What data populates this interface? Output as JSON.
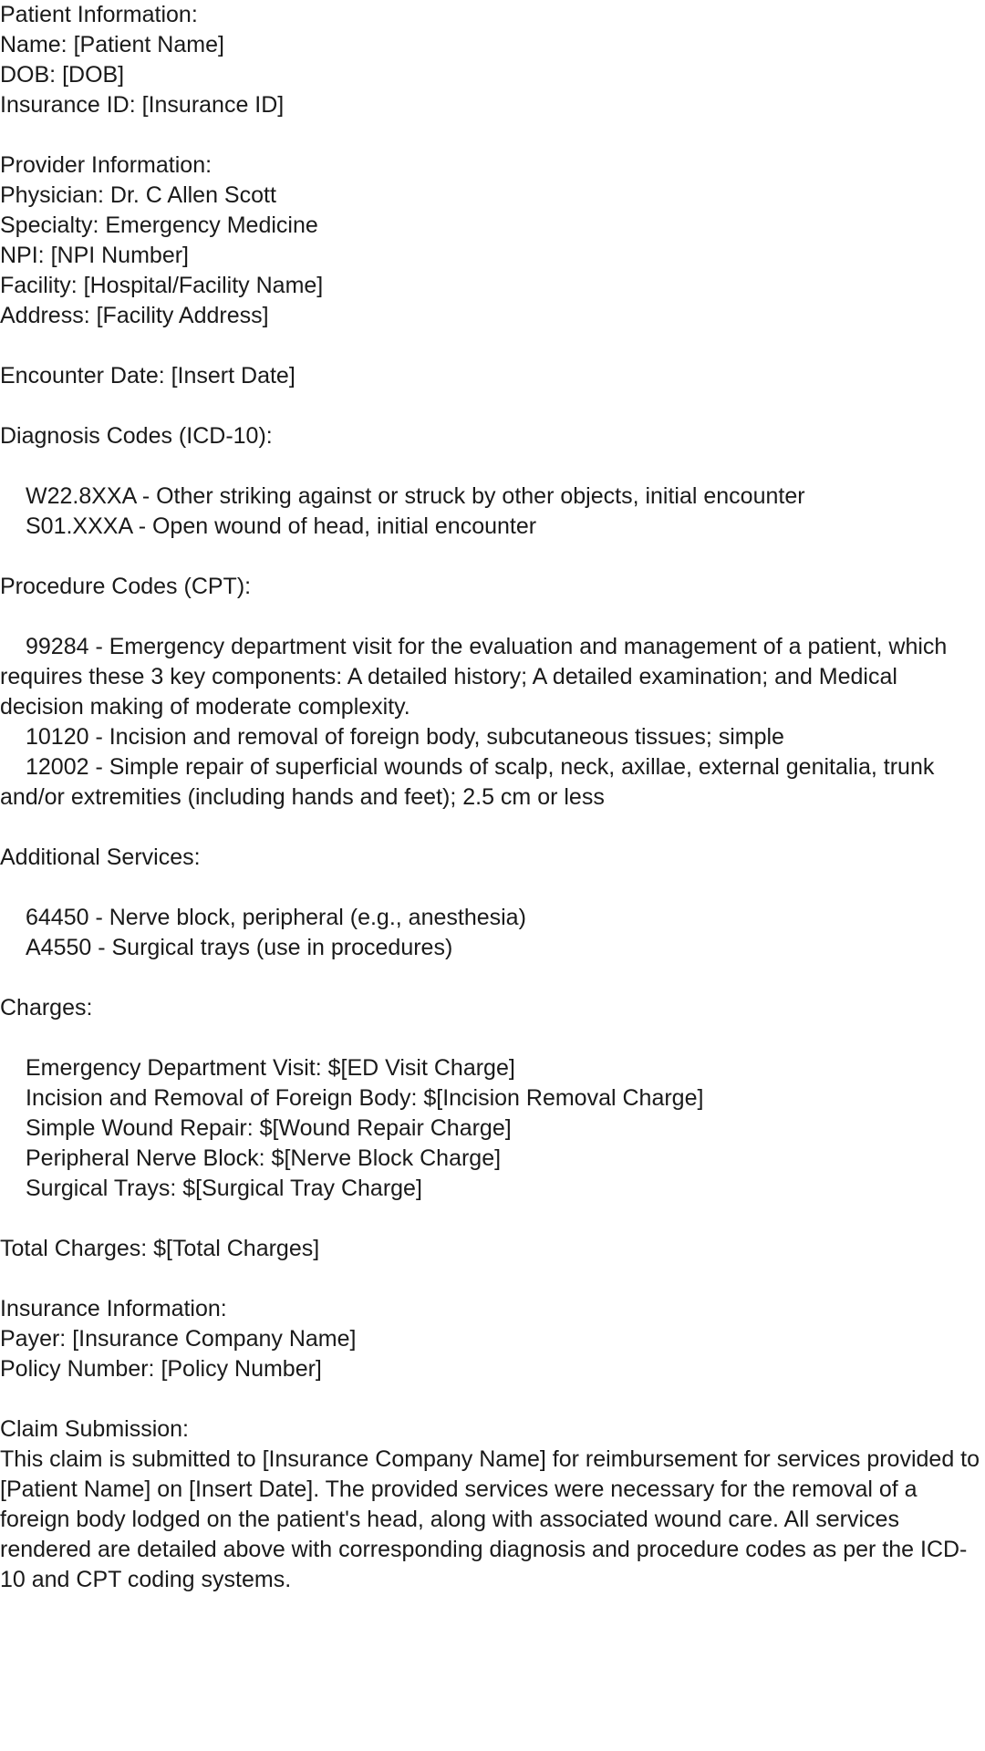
{
  "patient": {
    "heading": "Patient Information:",
    "name": "Name: [Patient Name]",
    "dob": "DOB: [DOB]",
    "insurance_id": "Insurance ID: [Insurance ID]"
  },
  "provider": {
    "heading": "Provider Information:",
    "physician": "Physician: Dr. C Allen Scott",
    "specialty": "Specialty: Emergency Medicine",
    "npi": "NPI: [NPI Number]",
    "facility": "Facility: [Hospital/Facility Name]",
    "address": "Address: [Facility Address]"
  },
  "encounter": {
    "date": "Encounter Date: [Insert Date]"
  },
  "diagnosis": {
    "heading": "Diagnosis Codes (ICD-10):",
    "items": [
      "W22.8XXA - Other striking against or struck by other objects, initial encounter",
      "S01.XXXA - Open wound of head, initial encounter"
    ]
  },
  "procedures": {
    "heading": "Procedure Codes (CPT):",
    "items": [
      "99284 - Emergency department visit for the evaluation and management of a patient, which requires these 3 key components: A detailed history; A detailed examination; and Medical decision making of moderate complexity.",
      "10120 - Incision and removal of foreign body, subcutaneous tissues; simple",
      "12002 - Simple repair of superficial wounds of scalp, neck, axillae, external genitalia, trunk and/or extremities (including hands and feet); 2.5 cm or less"
    ]
  },
  "additional": {
    "heading": "Additional Services:",
    "items": [
      "64450 - Nerve block, peripheral (e.g., anesthesia)",
      "A4550 - Surgical trays (use in procedures)"
    ]
  },
  "charges": {
    "heading": "Charges:",
    "items": [
      "Emergency Department Visit: $[ED Visit Charge]",
      "Incision and Removal of Foreign Body: $[Incision Removal Charge]",
      "Simple Wound Repair: $[Wound Repair Charge]",
      "Peripheral Nerve Block: $[Nerve Block Charge]",
      "Surgical Trays: $[Surgical Tray Charge]"
    ],
    "total": "Total Charges: $[Total Charges]"
  },
  "insurance": {
    "heading": "Insurance Information:",
    "payer": "Payer: [Insurance Company Name]",
    "policy": "Policy Number: [Policy Number]"
  },
  "claim": {
    "heading": "Claim Submission:",
    "body": "This claim is submitted to [Insurance Company Name] for reimbursement for services provided to [Patient Name] on [Insert Date]. The provided services were necessary for the removal of a foreign body lodged on the patient's head, along with associated wound care. All services rendered are detailed above with corresponding diagnosis and procedure codes as per the ICD-10 and CPT coding systems."
  }
}
